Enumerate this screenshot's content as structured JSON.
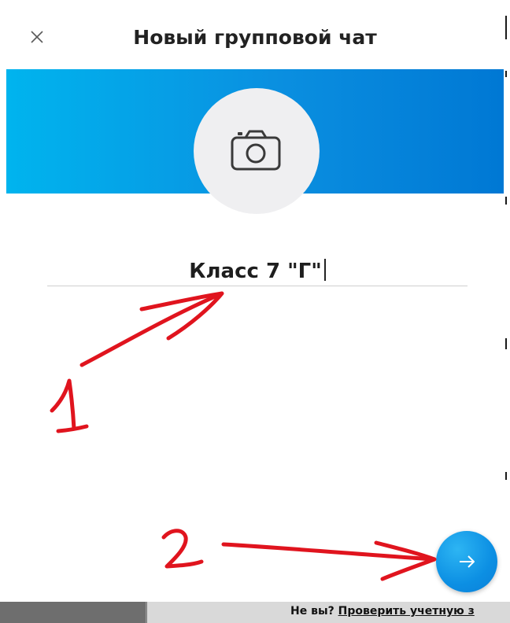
{
  "dialog": {
    "title": "Новый групповой чат",
    "close_icon": "close-icon",
    "camera_icon": "camera-icon"
  },
  "group_name": {
    "value": "Класс 7 \"Г\""
  },
  "next_button": {
    "icon": "arrow-right-icon",
    "color": "#0c8fe3"
  },
  "annotations": {
    "label_1": "1",
    "label_2": "2",
    "color": "#e0141e"
  },
  "footer": {
    "prompt": "Не вы?",
    "link": "Проверить учетную з"
  },
  "colors": {
    "banner_start": "#00b4ee",
    "banner_end": "#0078d4"
  }
}
